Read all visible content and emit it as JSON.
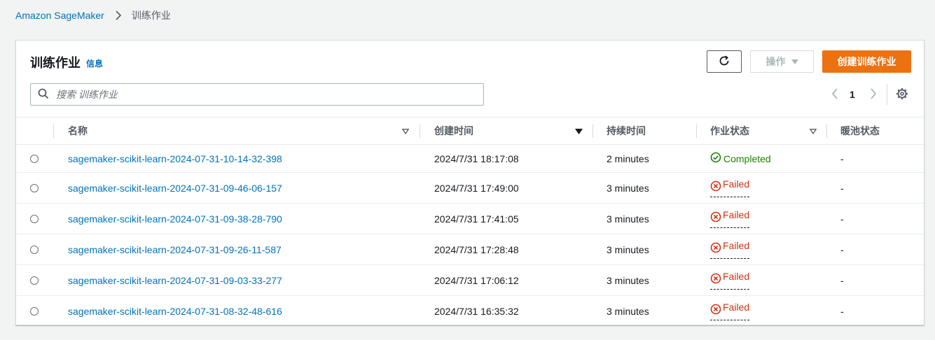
{
  "breadcrumb": {
    "root": "Amazon SageMaker",
    "current": "训练作业"
  },
  "panel": {
    "title": "训练作业",
    "info_link": "信息",
    "actions_label": "操作",
    "create_label": "创建训练作业"
  },
  "search": {
    "placeholder": "搜索 训练作业",
    "value": ""
  },
  "pagination": {
    "current_page": "1"
  },
  "table": {
    "columns": {
      "name": "名称",
      "created": "创建时间",
      "duration": "持续时间",
      "status": "作业状态",
      "warm_pool": "暖池状态"
    },
    "rows": [
      {
        "name": "sagemaker-scikit-learn-2024-07-31-10-14-32-398",
        "created": "2024/7/31 18:17:08",
        "duration": "2 minutes",
        "status": "Completed",
        "warm_pool": "-"
      },
      {
        "name": "sagemaker-scikit-learn-2024-07-31-09-46-06-157",
        "created": "2024/7/31 17:49:00",
        "duration": "3 minutes",
        "status": "Failed",
        "warm_pool": "-"
      },
      {
        "name": "sagemaker-scikit-learn-2024-07-31-09-38-28-790",
        "created": "2024/7/31 17:41:05",
        "duration": "3 minutes",
        "status": "Failed",
        "warm_pool": "-"
      },
      {
        "name": "sagemaker-scikit-learn-2024-07-31-09-26-11-587",
        "created": "2024/7/31 17:28:48",
        "duration": "3 minutes",
        "status": "Failed",
        "warm_pool": "-"
      },
      {
        "name": "sagemaker-scikit-learn-2024-07-31-09-03-33-277",
        "created": "2024/7/31 17:06:12",
        "duration": "3 minutes",
        "status": "Failed",
        "warm_pool": "-"
      },
      {
        "name": "sagemaker-scikit-learn-2024-07-31-08-32-48-616",
        "created": "2024/7/31 16:35:32",
        "duration": "3 minutes",
        "status": "Failed",
        "warm_pool": "-"
      }
    ]
  },
  "colors": {
    "link": "#0073bb",
    "primary_button": "#ec7211",
    "success": "#1d8102",
    "error": "#d13212"
  },
  "icons": [
    "chevron-right-icon",
    "refresh-icon",
    "caret-down-icon",
    "search-icon",
    "chevron-left-icon",
    "gear-icon",
    "sort-caret-icon",
    "check-circle-icon",
    "x-circle-icon"
  ]
}
